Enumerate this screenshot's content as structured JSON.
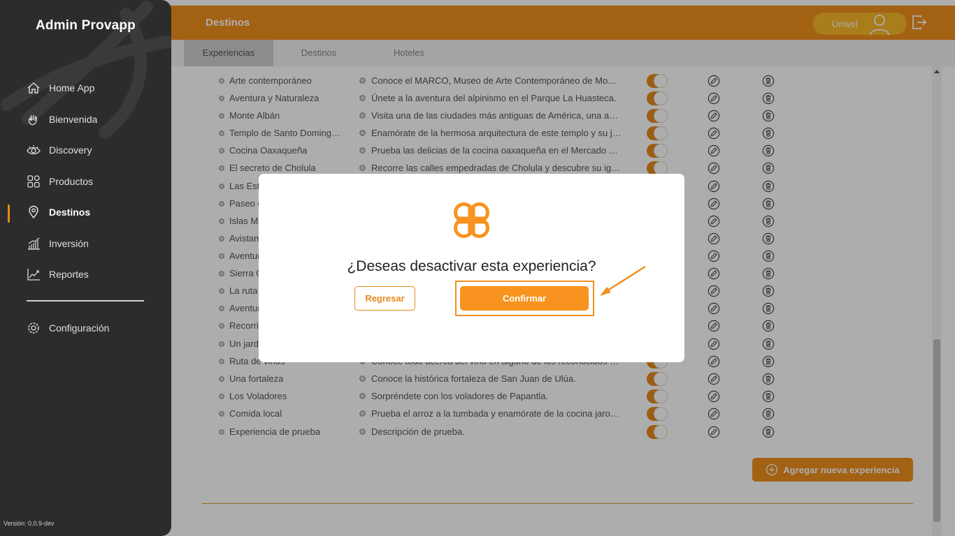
{
  "app": {
    "title": "Admin Provapp",
    "version": "Versión: 0.0.9-dev"
  },
  "sidebar": {
    "items": [
      {
        "label": "Home App",
        "icon": "home-icon"
      },
      {
        "label": "Bienvenida",
        "icon": "wave-hand-icon"
      },
      {
        "label": "Discovery",
        "icon": "eye-icon"
      },
      {
        "label": "Productos",
        "icon": "grid-icon"
      },
      {
        "label": "Destinos",
        "icon": "location-pin-icon",
        "active": true
      },
      {
        "label": "Inversión",
        "icon": "bar-chart-icon"
      },
      {
        "label": "Reportes",
        "icon": "line-chart-icon"
      }
    ],
    "config": {
      "label": "Configuración",
      "icon": "gear-icon"
    }
  },
  "header": {
    "title": "Destinos",
    "user_name": "Umvel"
  },
  "tabs": [
    {
      "label": "Experiencias",
      "active": true
    },
    {
      "label": "Destinos"
    },
    {
      "label": "Hoteles"
    }
  ],
  "table": {
    "rows": [
      {
        "name": "Arte contemporáneo",
        "desc": "Conoce el MARCO, Museo de Arte Contemporáneo de Monterrey."
      },
      {
        "name": "Aventura y Naturaleza",
        "desc": "Únete a la aventura del alpinismo en el Parque La Huasteca."
      },
      {
        "name": "Monte Albán",
        "desc": "Visita una de las ciudades más antiguas de América, una antigua capital zapoteca."
      },
      {
        "name": "Templo de Santo Domingo de Guzmán",
        "desc": "Enamórate de la hermosa arquitectura de este templo y su jardín."
      },
      {
        "name": "Cocina Oaxaqueña",
        "desc": "Prueba las delicias de la cocina oaxaqueña en el Mercado Benito Juárez."
      },
      {
        "name": "El secreto de Cholula",
        "desc": "Recorre las calles empedradas de Cholula y descubre su iglesia."
      },
      {
        "name": "Las Est",
        "desc": ""
      },
      {
        "name": "Paseo e",
        "desc": ""
      },
      {
        "name": "Islas Ma",
        "desc": ""
      },
      {
        "name": "Avistam",
        "desc": ""
      },
      {
        "name": "Aventur",
        "desc": ""
      },
      {
        "name": "Sierra G",
        "desc": ""
      },
      {
        "name": "La ruta",
        "desc": ""
      },
      {
        "name": "Aventur",
        "desc": ""
      },
      {
        "name": "Recorri",
        "desc": ""
      },
      {
        "name": "Un jardí",
        "desc": ""
      },
      {
        "name": "Ruta de vinos",
        "desc": "Conoce todo acerca del vino en alguno de los reconocidos viñedos."
      },
      {
        "name": "Una fortaleza",
        "desc": "Conoce la histórica fortaleza de San Juan de Ulúa."
      },
      {
        "name": "Los Voladores",
        "desc": "Sorpréndete con los voladores de Papantla."
      },
      {
        "name": "Comida local",
        "desc": "Prueba el arroz a la tumbada y enamórate de la cocina jarocha."
      },
      {
        "name": "Experiencia de prueba",
        "desc": "Descripción de prueba."
      }
    ],
    "add_button": "Agregar nueva experiencia"
  },
  "modal": {
    "question": "¿Deseas desactivar esta experiencia?",
    "back_label": "Regresar",
    "confirm_label": "Confirmar"
  },
  "colors": {
    "accent": "#f0901d",
    "sidebar": "#2c2c2c",
    "user_pill": "#f9b72a"
  }
}
